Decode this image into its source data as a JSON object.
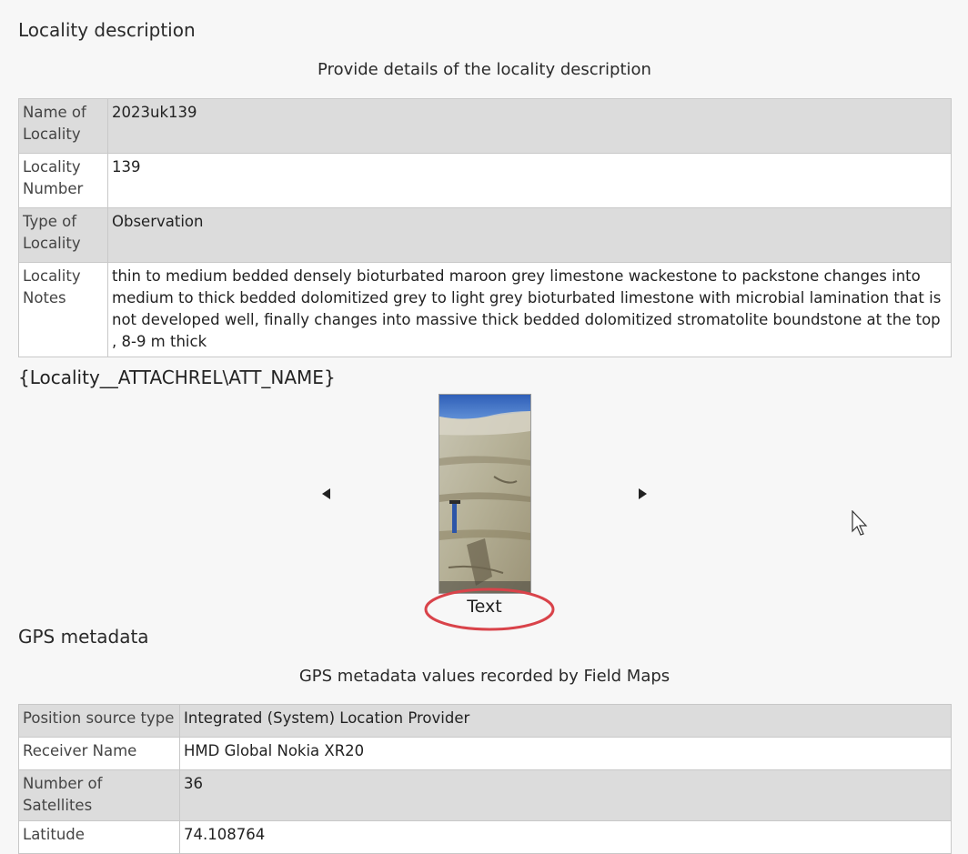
{
  "locality": {
    "title": "Locality description",
    "subtitle": "Provide details of the locality description",
    "rows": [
      {
        "key": "Name of Locality",
        "value": "2023uk139"
      },
      {
        "key": "Locality Number",
        "value": "139"
      },
      {
        "key": "Type of Locality",
        "value": "Observation"
      },
      {
        "key": "Locality Notes",
        "value": "thin to medium bedded densely bioturbated maroon grey limestone wackestone to packstone changes into medium to thick bedded dolomitized grey to light grey bioturbated limestone with microbial lamination that is not developed well, finally changes into massive thick bedded dolomitized stromatolite boundstone at the top , 8-9 m thick"
      }
    ]
  },
  "attachment": {
    "name_placeholder": "{Locality__ATTACHREL\\ATT_NAME}",
    "caption": "Text",
    "highlight_color": "#d9434a"
  },
  "gps": {
    "title": "GPS metadata",
    "subtitle": "GPS metadata values recorded by Field Maps",
    "rows": [
      {
        "key": "Position source type",
        "value": "Integrated (System) Location Provider"
      },
      {
        "key": "Receiver Name",
        "value": "HMD Global Nokia XR20"
      },
      {
        "key": "Number of Satellites",
        "value": "36"
      },
      {
        "key": "Latitude",
        "value": "74.108764"
      }
    ]
  },
  "icons": {
    "prev": "left-arrow-icon",
    "next": "right-arrow-icon",
    "cursor": "mouse-cursor-icon"
  }
}
